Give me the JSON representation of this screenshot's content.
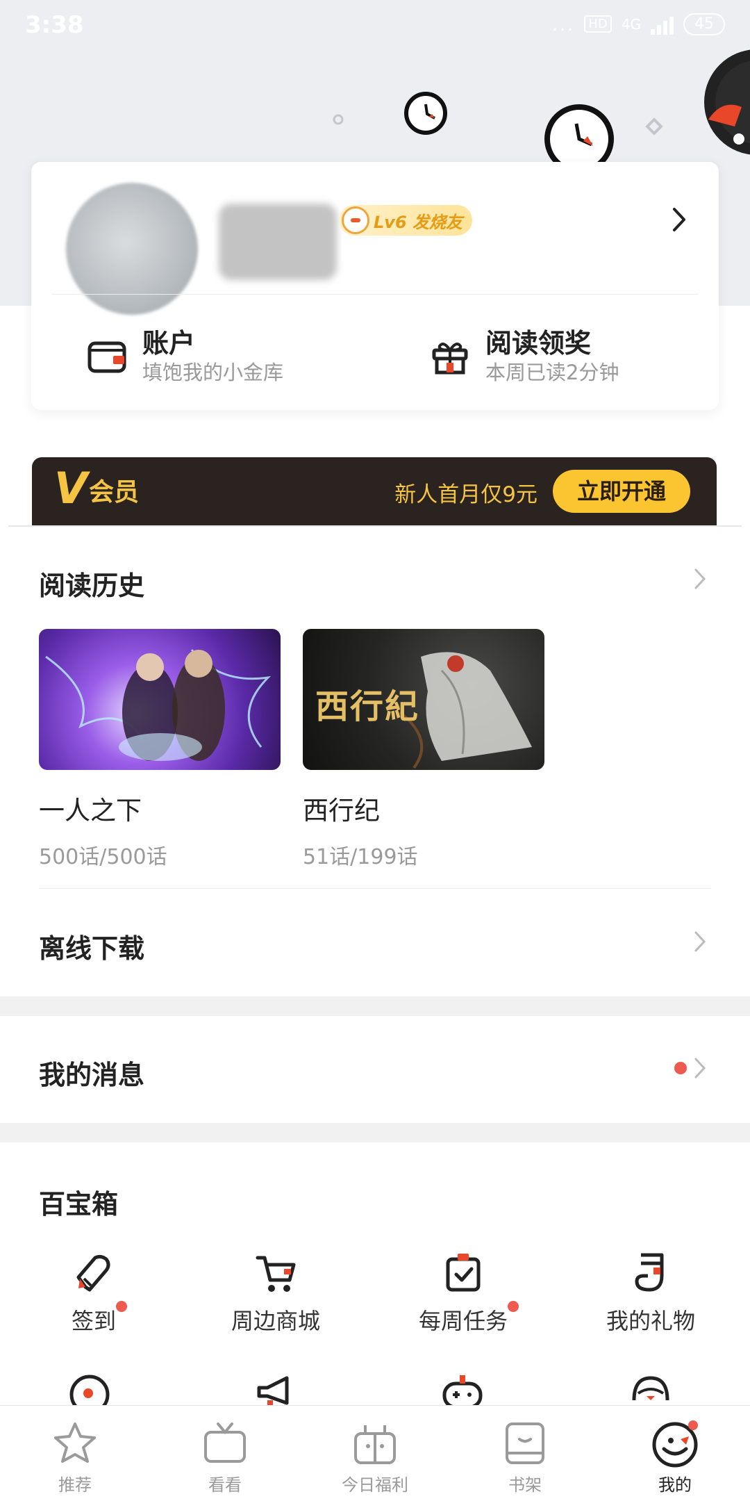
{
  "status_bar": {
    "time": "3:38",
    "dots": "...",
    "hd": "HD",
    "net": "4G",
    "battery": "45"
  },
  "profile": {
    "level_badge": "Lv6 发烧友",
    "account": {
      "title": "账户",
      "subtitle": "填饱我的小金库"
    },
    "reading_reward": {
      "title": "阅读领奖",
      "subtitle": "本周已读2分钟"
    }
  },
  "vip": {
    "logo_v": "V",
    "logo_text": "会员",
    "promo": "新人首月仅9元",
    "button": "立即开通"
  },
  "reading_history": {
    "title": "阅读历史",
    "books": [
      {
        "title": "一人之下",
        "episodes": "500话/500话"
      },
      {
        "title": "西行纪",
        "episodes": "51话/199话",
        "cover_text": "西行紀"
      }
    ]
  },
  "offline_download": {
    "title": "离线下载"
  },
  "my_messages": {
    "title": "我的消息"
  },
  "toolbox": {
    "title": "百宝箱",
    "items": [
      {
        "label": "签到",
        "icon": "pen-icon",
        "dot": true
      },
      {
        "label": "周边商城",
        "icon": "cart-icon",
        "dot": false
      },
      {
        "label": "每周任务",
        "icon": "task-clipboard-icon",
        "dot": true
      },
      {
        "label": "我的礼物",
        "icon": "gift-sock-icon",
        "dot": false
      }
    ]
  },
  "bottom_nav": [
    {
      "label": "推荐",
      "icon": "star-icon"
    },
    {
      "label": "看看",
      "icon": "tv-icon"
    },
    {
      "label": "今日福利",
      "icon": "gift-box-icon"
    },
    {
      "label": "书架",
      "icon": "bookshelf-icon"
    },
    {
      "label": "我的",
      "icon": "mascot-face-icon",
      "active": true
    }
  ],
  "colors": {
    "accent": "#ef5a50",
    "vip_gold": "#f6c443",
    "vip_bg": "#2b2320",
    "button_yellow": "#fbc531"
  }
}
